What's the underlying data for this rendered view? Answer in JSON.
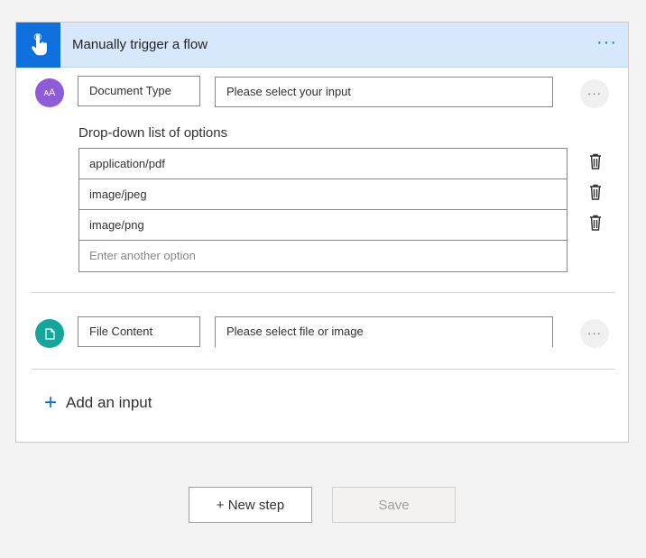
{
  "trigger": {
    "title": "Manually trigger a flow",
    "more_label": "···",
    "accent_color": "#0f6fdc",
    "icon": "touch-hand-icon"
  },
  "inputs": [
    {
      "avatar_label": "ᴀA",
      "avatar_icon": "text-aa-icon",
      "name": "Document Type",
      "value": "Please select your input",
      "more_label": "···",
      "dropdown_label": "Drop-down list of options",
      "options": [
        "application/pdf",
        "image/jpeg",
        "image/png"
      ],
      "option_placeholder": "Enter another option"
    },
    {
      "avatar_icon": "document-icon",
      "name": "File Content",
      "value": "Please select file or image",
      "more_label": "···"
    }
  ],
  "add_input": {
    "plus": "+",
    "label": "Add an input"
  },
  "actions": {
    "new_step": "+ New step",
    "save": "Save"
  }
}
